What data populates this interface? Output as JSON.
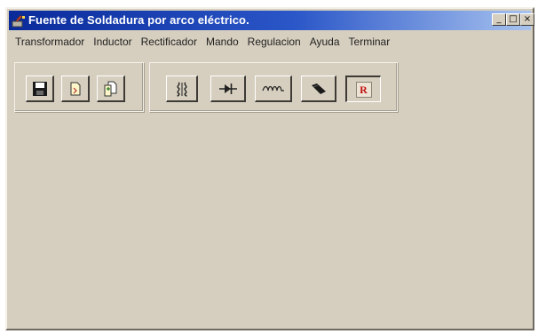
{
  "window": {
    "title": "Fuente de Soldadura por arco eléctrico.",
    "controls": {
      "minimize": "_",
      "maximize": "□",
      "close": "×"
    }
  },
  "menu": [
    {
      "label": "Transformador",
      "icon": ""
    },
    {
      "label": "Inductor"
    },
    {
      "label": "Rectificador"
    },
    {
      "label": "Mando"
    },
    {
      "label": "Regulacion"
    },
    {
      "label": "Ayuda"
    },
    {
      "label": "Terminar"
    }
  ],
  "toolbar": {
    "file_group": [
      {
        "icon": "save-disk-icon"
      },
      {
        "icon": "new-document-icon"
      },
      {
        "icon": "open-document-icon"
      }
    ],
    "component_group": [
      {
        "icon": "transformer-icon"
      },
      {
        "icon": "diode-icon"
      },
      {
        "icon": "inductor-coil-icon"
      },
      {
        "icon": "thyristor-icon"
      },
      {
        "icon": "regulation-r-icon",
        "label": "R",
        "pressed": true
      }
    ]
  },
  "colors": {
    "titlebar_start": "#0a2a9a",
    "titlebar_end": "#a8c3ef",
    "face": "#d6cfbf",
    "accent_r": "#c01010"
  }
}
